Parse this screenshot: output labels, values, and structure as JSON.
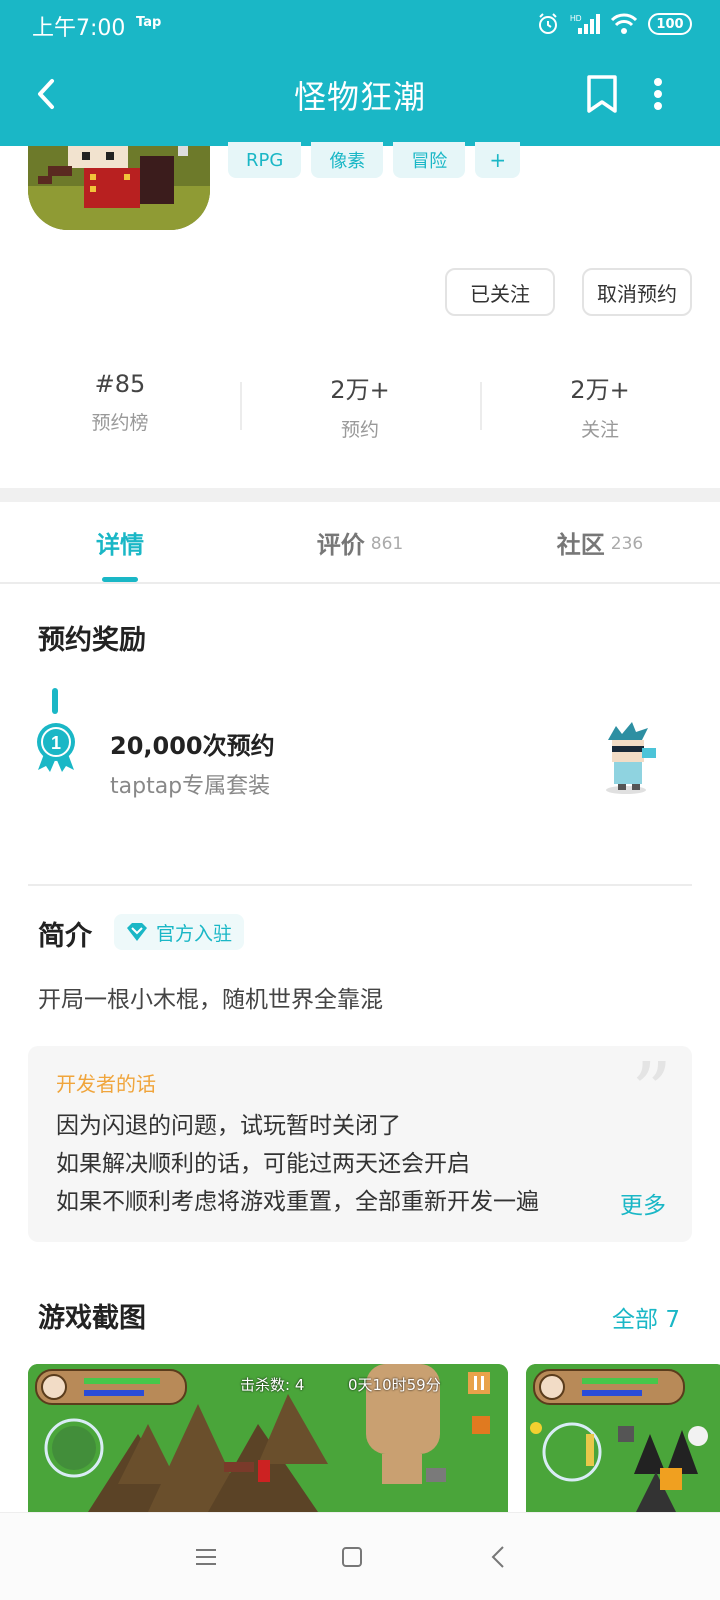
{
  "status": {
    "time": "上午7:00",
    "tap": "Tap",
    "network": "HD",
    "battery": "100"
  },
  "header": {
    "title": "怪物狂潮"
  },
  "tags": [
    "RPG",
    "像素",
    "冒险",
    "+"
  ],
  "actions": {
    "follow_label": "已关注",
    "cancel_label": "取消预约"
  },
  "stats": [
    {
      "value": "#85",
      "label": "预约榜"
    },
    {
      "value": "2万+",
      "label": "预约"
    },
    {
      "value": "2万+",
      "label": "关注"
    }
  ],
  "tabs": [
    {
      "label": "详情",
      "count": ""
    },
    {
      "label": "评价",
      "count": "861"
    },
    {
      "label": "社区",
      "count": "236"
    }
  ],
  "reward": {
    "section_title": "预约奖励",
    "medal_number": "1",
    "title": "20,000次预约",
    "subtitle": "taptap专属套装"
  },
  "intro": {
    "section_title": "简介",
    "badge": "官方入驻",
    "text": "开局一根小木棍，随机世界全靠混"
  },
  "developer_note": {
    "title": "开发者的话",
    "lines": [
      "因为闪退的问题，试玩暂时关闭了",
      "如果解决顺利的话，可能过两天还会开启",
      "如果不顺利考虑将游戏重置，全部重新开发一遍"
    ],
    "more_label": "更多"
  },
  "screenshots": {
    "section_title": "游戏截图",
    "all_label": "全部 7",
    "hud_kills": "击杀数: 4",
    "hud_time": "0天10时59分"
  },
  "colors": {
    "accent": "#1ab7c6",
    "orange": "#f0a53c"
  }
}
